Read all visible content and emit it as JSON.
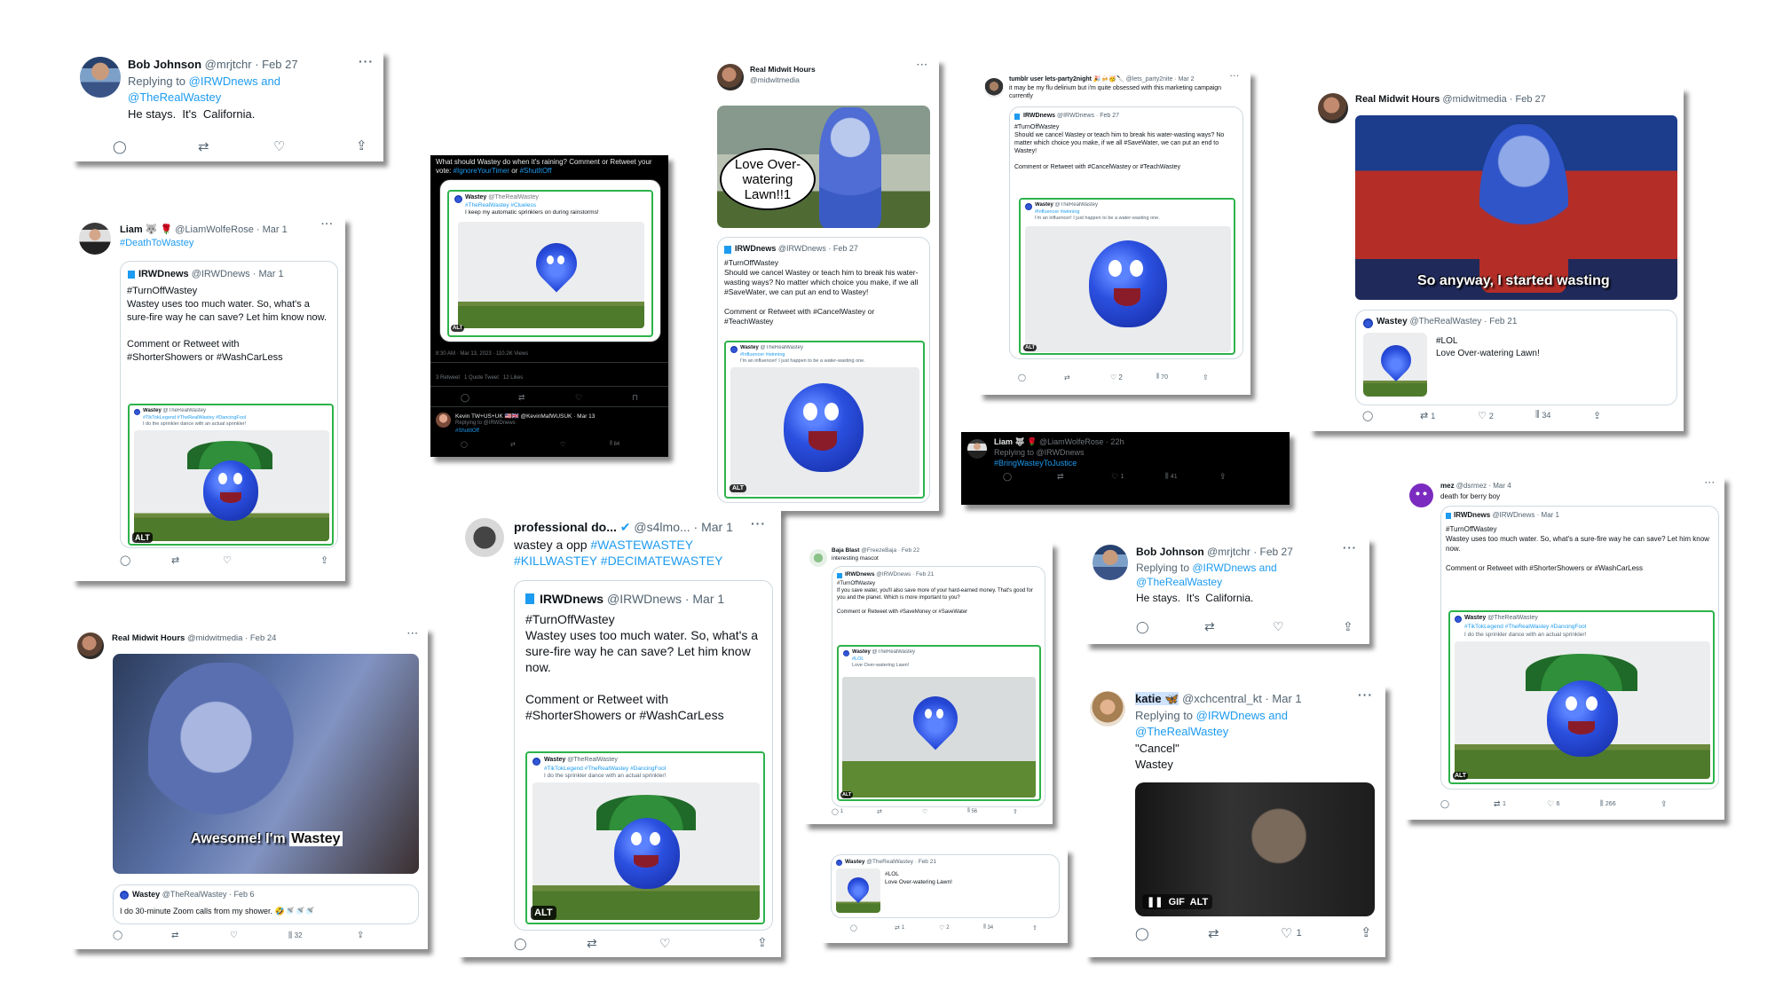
{
  "c1": {
    "name": "Bob Johnson",
    "handle": "@mrjtchr · Feb 27",
    "reply_prefix": "Replying to ",
    "reply_to": "@IRWDnews and",
    "reply_to2": "@TheRealWastey",
    "text": "He stays.  It's  California."
  },
  "c2": {
    "prompt": "What should Wastey do when it's raining? Comment or Retweet your vote: ",
    "tag1": "#IgnoreYourTimer",
    "or": " or ",
    "tag2": "#ShutItOff",
    "q_name": "Wastey",
    "q_handle": "@TheRealWastey",
    "q_tags": "#TheRealWastey #Clueless",
    "q_text": "I keep my automatic sprinklers on during rainstorms!",
    "alt": "ALT",
    "meta": "8:30 AM · Mar 13, 2023 · 110.2K Views",
    "stats": "3 Retweet   1 Quote Tweet   12 Likes",
    "r_name": "Kevin TW+US+UK 🇺🇸🇬🇧 @KevinMafWUSUK · Mar 13",
    "r_reply": "Replying to @IRWDnews",
    "r_tag": "#ShutItOff",
    "r_like": "84"
  },
  "c3": {
    "name": "Real Midwit Hours",
    "handle": "@midwitmedia",
    "bubble": "Love Over-watering Lawn!!1",
    "q_name": "IRWDnews",
    "q_handle": "@IRWDnews · Feb 27",
    "q_text": "#TurnOffWastey\nShould we cancel Wastey or teach him to break his water-wasting ways? No matter which choice you make, if we all #SaveWater, we can put an end to Wastey!\n\nComment or Retweet with #CancelWastey or #TeachWastey",
    "g_name": "Wastey",
    "g_handle": "@TheRealWastey",
    "g_tags": "#Influencer #winning",
    "g_text": "I'm an influencer! I just happen to be a water-wasting one.",
    "alt": "ALT"
  },
  "c4": {
    "name": "tumblr user lets-party2night 🎉🍻🥳🔪",
    "handle": "@lets_party2nite · Mar 2",
    "text": "it may be my flu delirium but i'm quite obsessed with this marketing campaign currently",
    "q_name": "IRWDnews",
    "q_handle": "@IRWDnews · Feb 27",
    "q_text": "#TurnOffWastey\nShould we cancel Wastey or teach him to break his water-wasting ways? No matter which choice you make, if we all #SaveWater, we can put an end to Wastey!\n\nComment or Retweet with #CancelWastey or #TeachWastey",
    "g_name": "Wastey",
    "g_handle": "@TheRealWastey",
    "g_tags": "#Influencer #winning",
    "g_text": "I'm an influencer! I just happen to be a water-wasting one.",
    "alt": "ALT",
    "likes": "2",
    "views": "70"
  },
  "c5": {
    "name": "Real Midwit Hours",
    "handle": "@midwitmedia · Feb 27",
    "caption": "So anyway, I started wasting",
    "q_name": "Wastey",
    "q_handle": "@TheRealWastey · Feb 21",
    "q_text": "#LOL\nLove Over-watering Lawn!",
    "rts": "1",
    "likes": "2",
    "views": "34"
  },
  "c6": {
    "name": "Liam 🐺 🌹",
    "handle": "@LiamWolfeRose · Mar 1",
    "tag": "#DeathToWastey",
    "q_name": "IRWDnews",
    "q_handle": "@IRWDnews · Mar 1",
    "q_text": "#TurnOffWastey\nWastey uses too much water. So, what's a sure-fire way he can save? Let him know now.\n\nComment or Retweet with\n#ShorterShowers or #WashCarLess",
    "g_name": "Wastey",
    "g_handle": "@TheRealWastey",
    "g_tags": "#TikTokLegend #TheRealWastey #DancingFool",
    "g_text": "I do the sprinkler dance with an actual sprinkler!",
    "alt": "ALT"
  },
  "c7": {
    "name": "Liam 🐺 🌹",
    "handle": "@LiamWolfeRose · 22h",
    "reply": "Replying to @IRWDnews",
    "tag": "#BringWasteyToJustice",
    "likes": "1",
    "views": "41"
  },
  "c8": {
    "name": "mez",
    "handle": "@dsrmez · Mar 4",
    "text": "death for berry boy",
    "q_name": "IRWDnews",
    "q_handle": "@IRWDnews · Mar 1",
    "q_text": "#TurnOffWastey\nWastey uses too much water. So, what's a sure-fire way he can save? Let him know now.\n\nComment or Retweet with #ShorterShowers or #WashCarLess",
    "g_name": "Wastey",
    "g_handle": "@TheRealWastey",
    "g_tags": "#TikTokLegend #TheRealWastey #DancingFool",
    "g_text": "I do the sprinkler dance with an actual sprinkler!",
    "alt": "ALT",
    "rts": "1",
    "likes": "6",
    "views": "266"
  },
  "c9": {
    "name": "Real Midwit Hours",
    "handle": "@midwitmedia · Feb 24",
    "caption1": "Awesome! I'm ",
    "caption2": "Wastey",
    "q_name": "Wastey",
    "q_handle": "@TheRealWastey · Feb 6",
    "q_text": "I do 30-minute Zoom calls from my shower. 🤣🚿🚿🚿",
    "views": "32"
  },
  "c10": {
    "name": "professional do...",
    "handle": "@s4lmo... · Mar 1",
    "text1": "wastey a opp ",
    "tag1": "#WASTEWASTEY",
    "tag2": "#KILLWASTEY #DECIMATEWASTEY",
    "q_name": "IRWDnews",
    "q_handle": "@IRWDnews · Mar 1",
    "q_text": "#TurnOffWastey\nWastey uses too much water. So, what's a sure-fire way he can save? Let him know now.\n\nComment or Retweet with\n#ShorterShowers or #WashCarLess",
    "g_name": "Wastey",
    "g_handle": "@TheRealWastey",
    "g_tags": "#TikTokLegend #TheRealWastey #DancingFool",
    "g_text": "I do the sprinkler dance with an actual sprinkler!",
    "alt": "ALT"
  },
  "c11": {
    "name": "Baja Blast",
    "handle": "@FreezeBaja · Feb 22",
    "text": "interesting mascot",
    "q_name": "IRWDnews",
    "q_handle": "@IRWDnews · Feb 21",
    "q_text": "#TurnOffWastey\nIf you save water, you'll also save more of your hard-earned money. That's good for you and the planet. Which is more important to you?\n\nComment or Retweet with #SaveMoney or #SaveWater",
    "g_name": "Wastey",
    "g_handle": "@TheRealWastey",
    "g_tags": "#LOL",
    "g_text": "Love Over-watering Lawn!",
    "alt": "ALT",
    "rts": "1",
    "views": "56"
  },
  "c12": {
    "name": "Wastey",
    "handle": "@TheRealWastey · Feb 21",
    "text": "#LOL\nLove Over-watering Lawn!",
    "rts": "1",
    "likes": "2",
    "views": "34"
  },
  "c13": {
    "name": "Bob Johnson",
    "handle": "@mrjtchr · Feb 27",
    "reply_prefix": "Replying to ",
    "reply_to": "@IRWDnews and",
    "reply_to2": "@TheRealWastey",
    "text": "He stays.  It's  California."
  },
  "c14": {
    "name": "katie 🦋",
    "handle": "@xchcentral_kt · Mar 1",
    "reply_prefix": "Replying to ",
    "reply_to": "@IRWDnews and",
    "reply_to2": "@TheRealWastey",
    "text": "\"Cancel\"\nWastey",
    "gif": "GIF",
    "alt": "ALT",
    "likes": "1"
  },
  "colors": {
    "accent": "#1d9bf0",
    "green_border": "#2db34a",
    "wastey_blue": "#2b50e0"
  }
}
